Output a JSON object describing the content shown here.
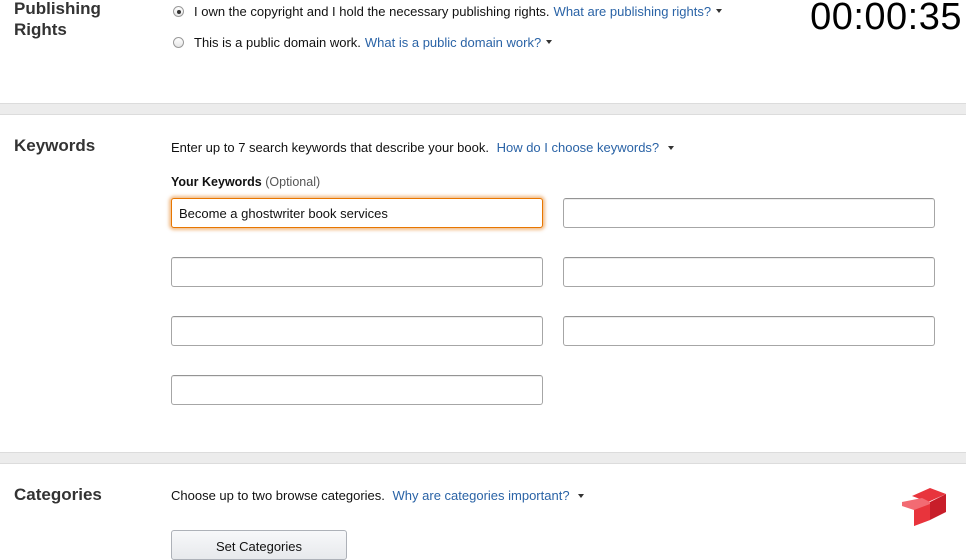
{
  "timer": "00:00:35",
  "publishing_rights": {
    "title_line1": "Publishing",
    "title_line2": "Rights",
    "option_own": {
      "label": "I own the copyright and I hold the necessary publishing rights.",
      "link": "What are publishing rights?",
      "checked": true
    },
    "option_public": {
      "label": "This is a public domain work.",
      "link": "What is a public domain work?",
      "checked": false
    }
  },
  "keywords": {
    "title": "Keywords",
    "help_text": "Enter up to 7 search keywords that describe your book.",
    "help_link": "How do I choose keywords?",
    "label": "Your Keywords",
    "label_optional": "(Optional)",
    "values": [
      "Become a ghostwriter book services",
      "",
      "",
      "",
      "",
      "",
      ""
    ]
  },
  "categories": {
    "title": "Categories",
    "help_text": "Choose up to two browse categories.",
    "help_link": "Why are categories important?",
    "button_label": "Set Categories"
  },
  "colors": {
    "link": "#2a63a6",
    "focus": "#e77600",
    "logo_red": "#e8343c"
  }
}
